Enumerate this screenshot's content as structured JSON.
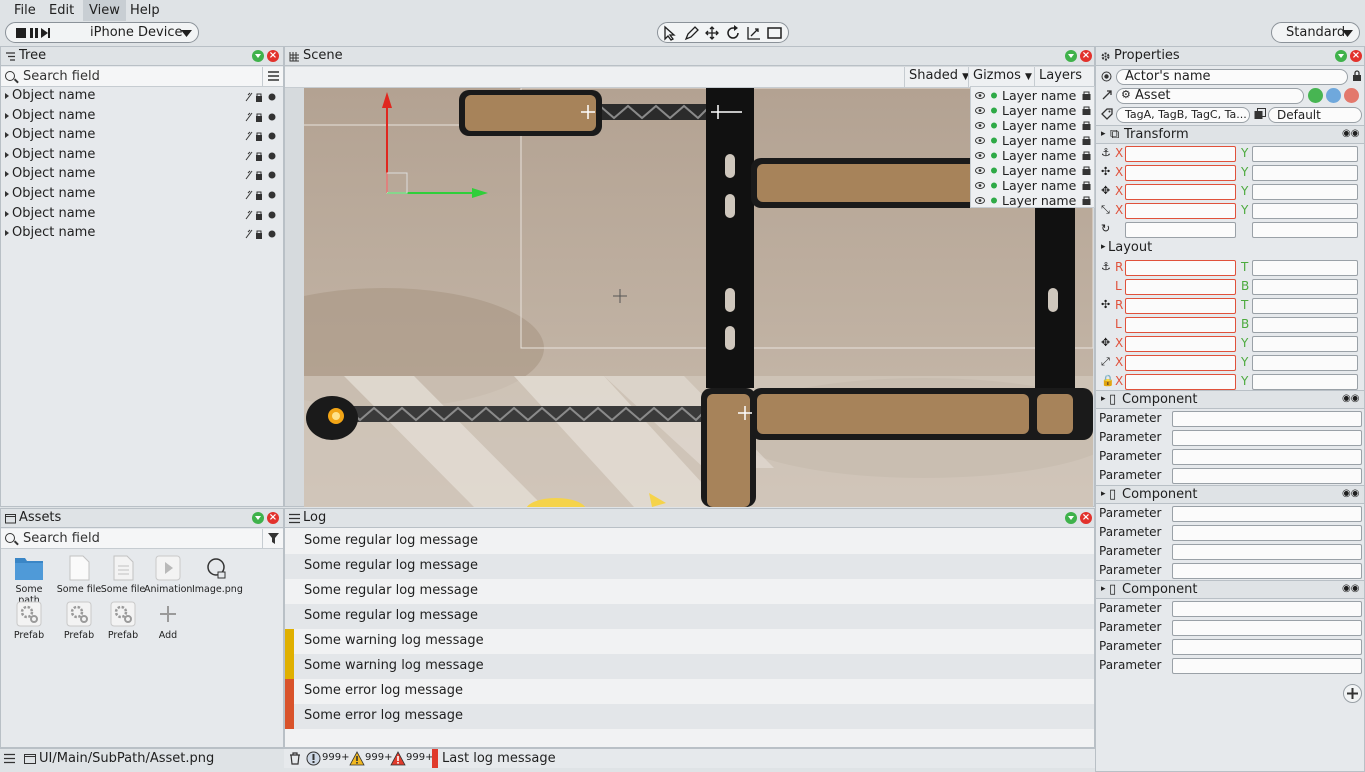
{
  "menu": [
    "File",
    "Edit",
    "View",
    "Help"
  ],
  "toolbar": {
    "device": "iPhone Device",
    "layout": "Standard"
  },
  "tree": {
    "title": "Tree",
    "search_placeholder": "Search field",
    "items": [
      "Object name",
      "Object name",
      "Object name",
      "Object name",
      "Object name",
      "Object name",
      "Object name",
      "Object name"
    ]
  },
  "scene": {
    "title": "Scene",
    "shading": "Shaded",
    "gizmos": "Gizmos",
    "layers": "Layers",
    "layer_list": [
      "Layer name",
      "Layer name",
      "Layer name",
      "Layer name",
      "Layer name",
      "Layer name",
      "Layer name",
      "Layer name"
    ]
  },
  "properties": {
    "title": "Properties",
    "actor_name": "Actor's name",
    "asset": "Asset",
    "tags": "TagA, TagB, TagC, Ta...",
    "tag_mode": "Default",
    "transform": "Transform",
    "layout": "Layout",
    "components": [
      {
        "name": "Component",
        "params": [
          "Parameter",
          "Parameter",
          "Parameter",
          "Parameter"
        ]
      },
      {
        "name": "Component",
        "params": [
          "Parameter",
          "Parameter",
          "Parameter",
          "Parameter"
        ]
      },
      {
        "name": "Component",
        "params": [
          "Parameter",
          "Parameter",
          "Parameter",
          "Parameter"
        ]
      }
    ],
    "axis": {
      "x": "X",
      "y": "Y",
      "r": "R",
      "t": "T",
      "l": "L",
      "b": "B"
    }
  },
  "assets": {
    "title": "Assets",
    "search_placeholder": "Search field",
    "items": [
      "Some path",
      "Some file",
      "Some file",
      "Animation",
      "Image.png",
      "Prefab",
      "Prefab",
      "Prefab",
      "Add"
    ],
    "path": "UI/Main/SubPath/Asset.png"
  },
  "log": {
    "title": "Log",
    "messages": [
      {
        "text": "Some regular log message",
        "level": "regular"
      },
      {
        "text": "Some regular log message",
        "level": "regular"
      },
      {
        "text": "Some regular log message",
        "level": "regular"
      },
      {
        "text": "Some regular log message",
        "level": "regular"
      },
      {
        "text": "Some warning log message",
        "level": "warning"
      },
      {
        "text": "Some warning log message",
        "level": "warning"
      },
      {
        "text": "Some error log message",
        "level": "error"
      },
      {
        "text": "Some error log message",
        "level": "error"
      }
    ],
    "info_count": "999+",
    "warning_count": "999+",
    "error_count": "999+",
    "last_message": "Last log message"
  },
  "colors": {
    "accent_green": "#3fb24b",
    "close_red": "#e2322c",
    "warning": "#e0b000",
    "error": "#d9532b"
  }
}
